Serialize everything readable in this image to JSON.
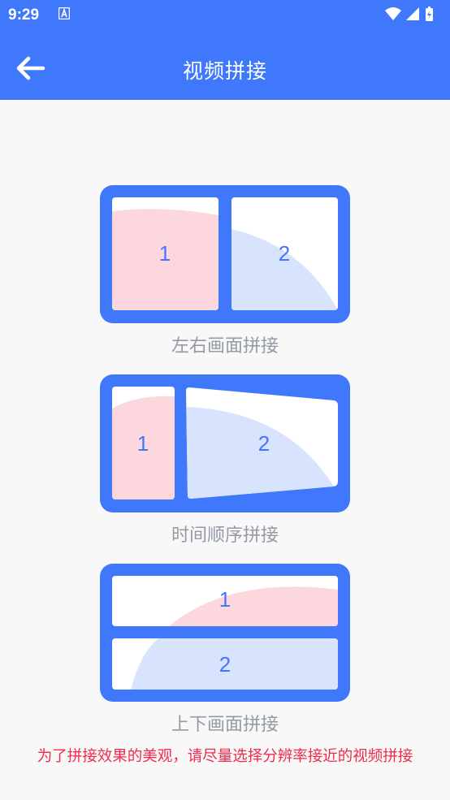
{
  "status_bar": {
    "time": "9:29",
    "icons": [
      "notification-a-icon",
      "wifi-icon",
      "signal-icon",
      "battery-icon"
    ]
  },
  "app_bar": {
    "title": "视频拼接",
    "back_icon": "arrow-left-icon"
  },
  "options": [
    {
      "caption": "左右画面拼接",
      "panels": [
        "1",
        "2"
      ]
    },
    {
      "caption": "时间顺序拼接",
      "panels": [
        "1",
        "2"
      ]
    },
    {
      "caption": "上下画面拼接",
      "panels": [
        "1",
        "2"
      ]
    }
  ],
  "notice": "为了拼接效果的美观，请尽量选择分辨率接近的视频拼接",
  "colors": {
    "primary": "#3f78fb",
    "panel_pink": "#fdd7de",
    "panel_blue": "#d8e3fd",
    "caption": "#939aa6",
    "notice": "#ef2c4b"
  }
}
